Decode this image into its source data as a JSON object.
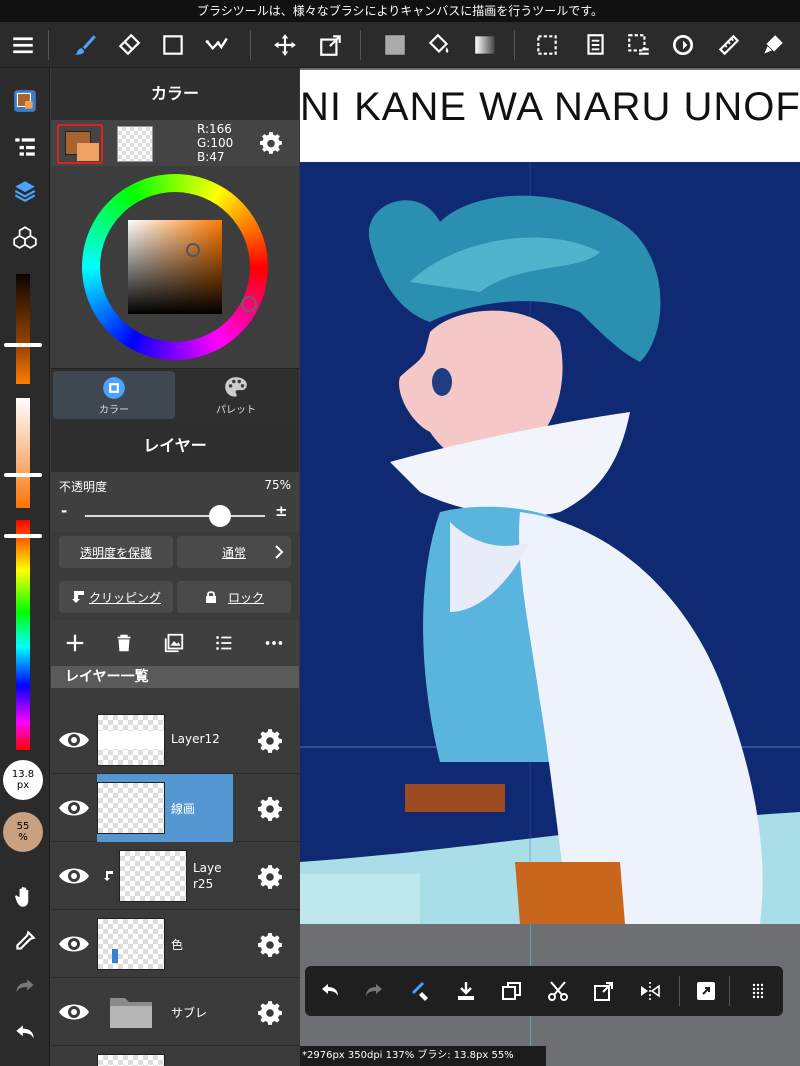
{
  "tip": "ブラシツールは、様々なブラシによりキャンバスに描画を行うツールです。",
  "color_panel": {
    "title": "カラー",
    "rgb": {
      "r": "R:166",
      "g": "G:100",
      "b": "B:47"
    },
    "main_color": "#a6642f",
    "tabs": [
      {
        "label": "カラー"
      },
      {
        "label": "パレット"
      }
    ]
  },
  "layer_panel": {
    "title": "レイヤー",
    "opacity_label": "不透明度",
    "opacity_value": "75%",
    "opacity_level": 0.75,
    "minus": "-",
    "plus": "±",
    "protect_alpha": "透明度を保護",
    "blend_mode": "通常",
    "clipping": "クリッピング",
    "lock": "ロック",
    "list_header": "レイヤー一覧",
    "layers": [
      {
        "name": "Layer12"
      },
      {
        "name": "線画"
      },
      {
        "name": "Laye\nr25"
      },
      {
        "name": "色"
      },
      {
        "name": "サブレ"
      }
    ]
  },
  "left_strip": {
    "brush_size": "13.8\npx",
    "brush_opacity": "55\n%"
  },
  "canvas": {
    "title_text": "NI KANE WA NARU UNOFFIC"
  },
  "status_line": "*2976px 350dpi 137% ブラシ: 13.8px 55%",
  "colors": {
    "accent": "#5497d3",
    "bg": "#2b2b2b",
    "sky": "#0f2a72"
  }
}
